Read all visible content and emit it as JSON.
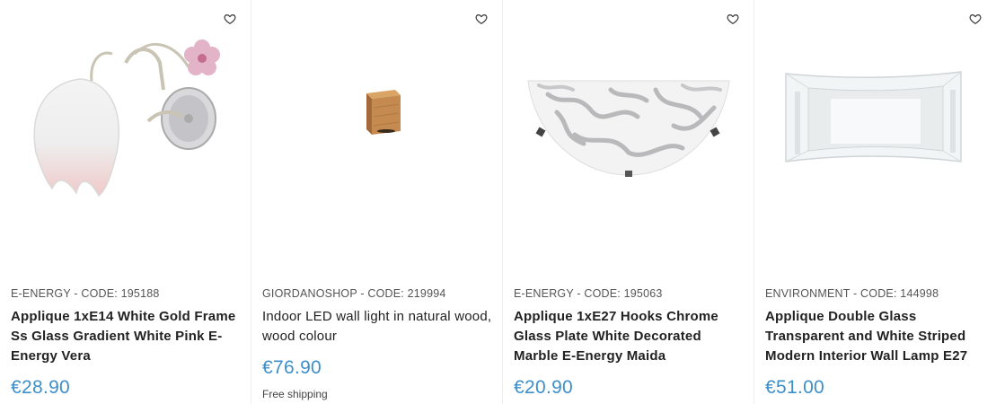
{
  "products": [
    {
      "brand_code": "E-ENERGY - CODE: 195188",
      "title": "Applique 1xE14 White Gold Frame Ss Glass Gradient White Pink E-Energy Vera",
      "price": "€28.90",
      "image_icon": "tulip-wall-lamp-image"
    },
    {
      "brand_code": "GIORDANOSHOP - CODE: 219994",
      "title": "Indoor LED wall light in natural wood, wood colour",
      "price": "€76.90",
      "shipping": "Free shipping",
      "image_icon": "wood-cube-wall-light-image"
    },
    {
      "brand_code": "E-ENERGY - CODE: 195063",
      "title": "Applique 1xE27 Hooks Chrome Glass Plate White Decorated Marble E-Energy Maida",
      "price": "€20.90",
      "image_icon": "marble-half-bowl-lamp-image"
    },
    {
      "brand_code": "ENVIRONMENT - CODE: 144998",
      "title": "Applique Double Glass Transparent and White Striped Modern Interior Wall Lamp E27",
      "price": "€51.00",
      "image_icon": "glass-panel-wall-lamp-image"
    }
  ],
  "colors": {
    "price": "#3d8fca",
    "divider": "#eeeeee"
  },
  "icons": {
    "wishlist": "heart-outline-icon"
  }
}
